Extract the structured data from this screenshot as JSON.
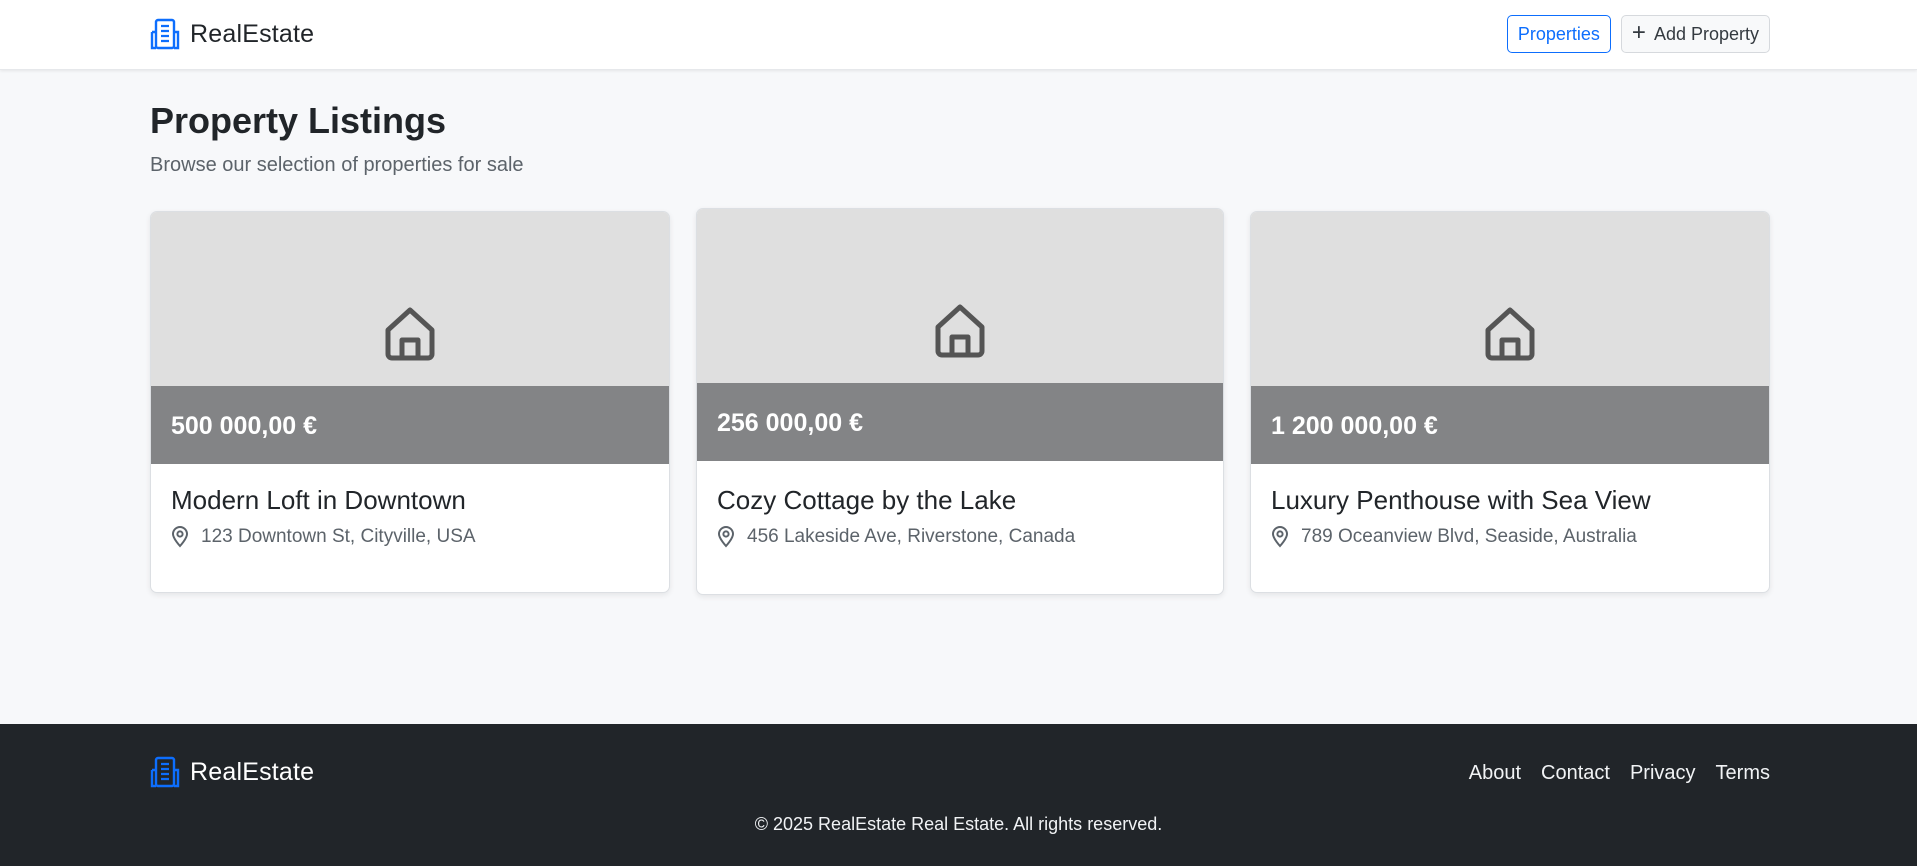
{
  "colors": {
    "accent": "#0d6efd",
    "footer_bg": "#212529",
    "price_bar": "#838486",
    "image_bg": "#dfdfdf"
  },
  "header": {
    "brand": "RealEstate",
    "brand_icon": "building-icon",
    "nav_properties": "Properties",
    "nav_add_property": "Add Property",
    "add_icon": "plus-icon"
  },
  "main": {
    "title": "Property Listings",
    "subtitle": "Browse our selection of properties for sale"
  },
  "listings": [
    {
      "price": "500 000,00 €",
      "title": "Modern Loft in Downtown",
      "address": "123 Downtown St, Cityville, USA",
      "image_icon": "house-icon",
      "location_icon": "map-pin-icon"
    },
    {
      "price": "256 000,00 €",
      "title": "Cozy Cottage by the Lake",
      "address": "456 Lakeside Ave, Riverstone, Canada",
      "image_icon": "house-icon",
      "location_icon": "map-pin-icon"
    },
    {
      "price": "1 200 000,00 €",
      "title": "Luxury Penthouse with Sea View",
      "address": "789 Oceanview Blvd, Seaside, Australia",
      "image_icon": "house-icon",
      "location_icon": "map-pin-icon"
    }
  ],
  "footer": {
    "brand": "RealEstate",
    "links": [
      "About",
      "Contact",
      "Privacy",
      "Terms"
    ],
    "copyright": "© 2025 RealEstate Real Estate. All rights reserved."
  }
}
